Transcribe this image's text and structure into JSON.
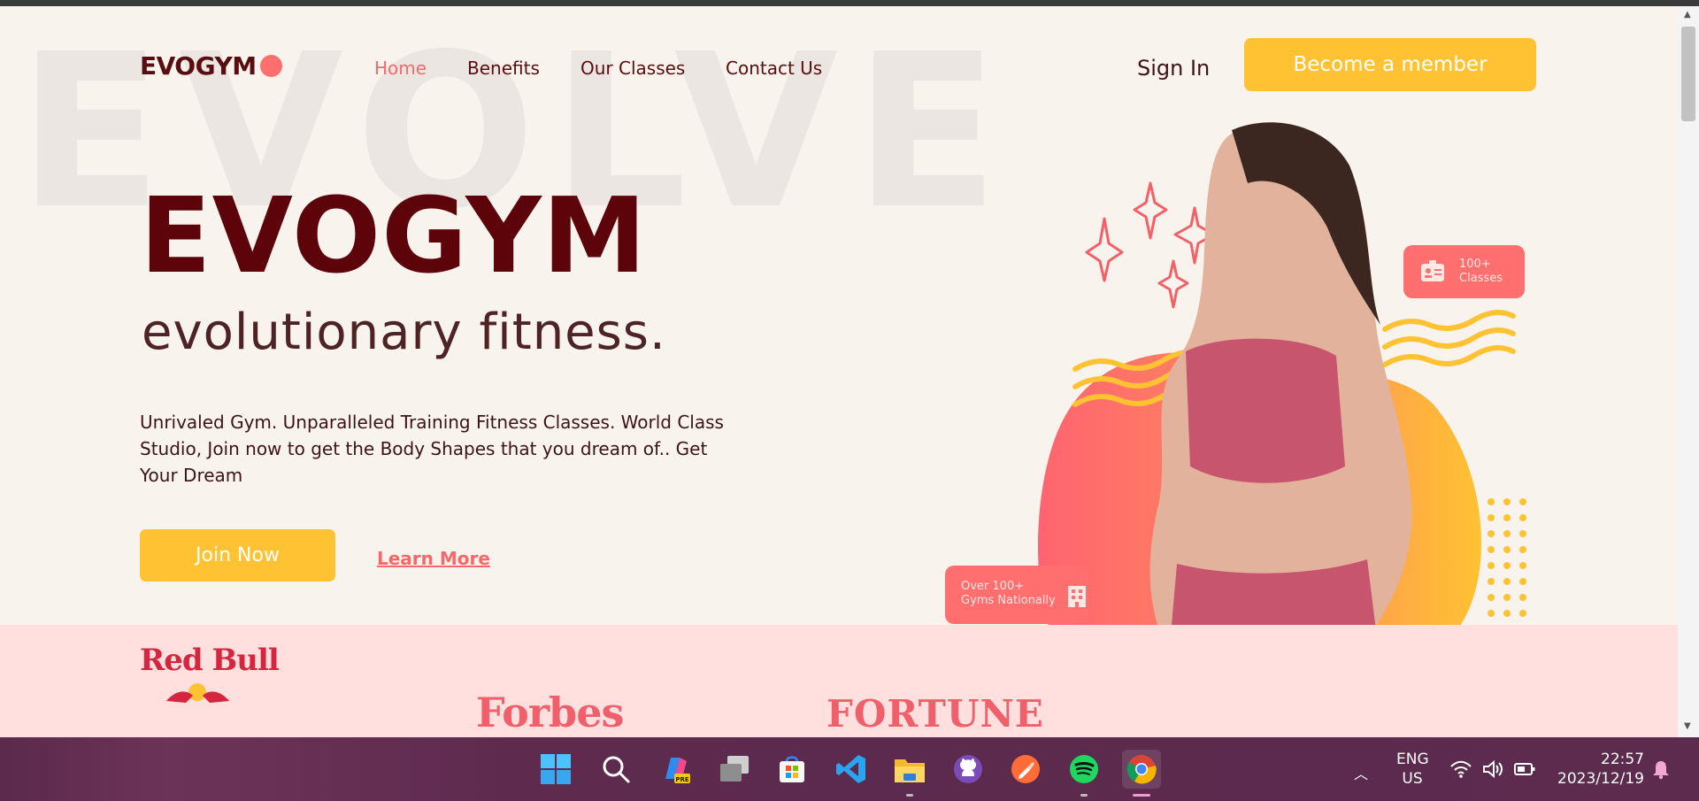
{
  "brand": {
    "logo_text": "EVOGYM",
    "accent_color": "#ff6f6f",
    "primary_color": "#ffc232",
    "dark_color": "#5c0409"
  },
  "nav": {
    "links": [
      {
        "label": "Home",
        "active": true
      },
      {
        "label": "Benefits",
        "active": false
      },
      {
        "label": "Our Classes",
        "active": false
      },
      {
        "label": "Contact Us",
        "active": false
      }
    ],
    "sign_in": "Sign In",
    "member_button": "Become a member"
  },
  "hero": {
    "background_word": "EVOLVE",
    "title": "EVOGYM",
    "subtitle": "evolutionary fitness.",
    "description": "Unrivaled Gym. Unparalleled Training Fitness Classes. World Class Studio, Join now to get the Body Shapes that you dream of.. Get Your Dream",
    "join_button": "Join Now",
    "learn_more": "Learn More"
  },
  "badges": {
    "classes_line1": "100+",
    "classes_line2": "Classes",
    "gyms_line1": "Over 100+",
    "gyms_line2": "Gyms Nationally"
  },
  "sponsors": {
    "redbull": "Red Bull",
    "forbes": "Forbes",
    "fortune": "FORTUNE"
  },
  "taskbar": {
    "icons": [
      "windows-start-icon",
      "search-icon",
      "copilot-icon",
      "task-view-icon",
      "microsoft-store-icon",
      "vscode-icon",
      "file-explorer-icon",
      "github-desktop-icon",
      "postman-icon",
      "spotify-icon",
      "chrome-icon"
    ],
    "lang_line1": "ENG",
    "lang_line2": "US",
    "time": "22:57",
    "date": "2023/12/19"
  }
}
